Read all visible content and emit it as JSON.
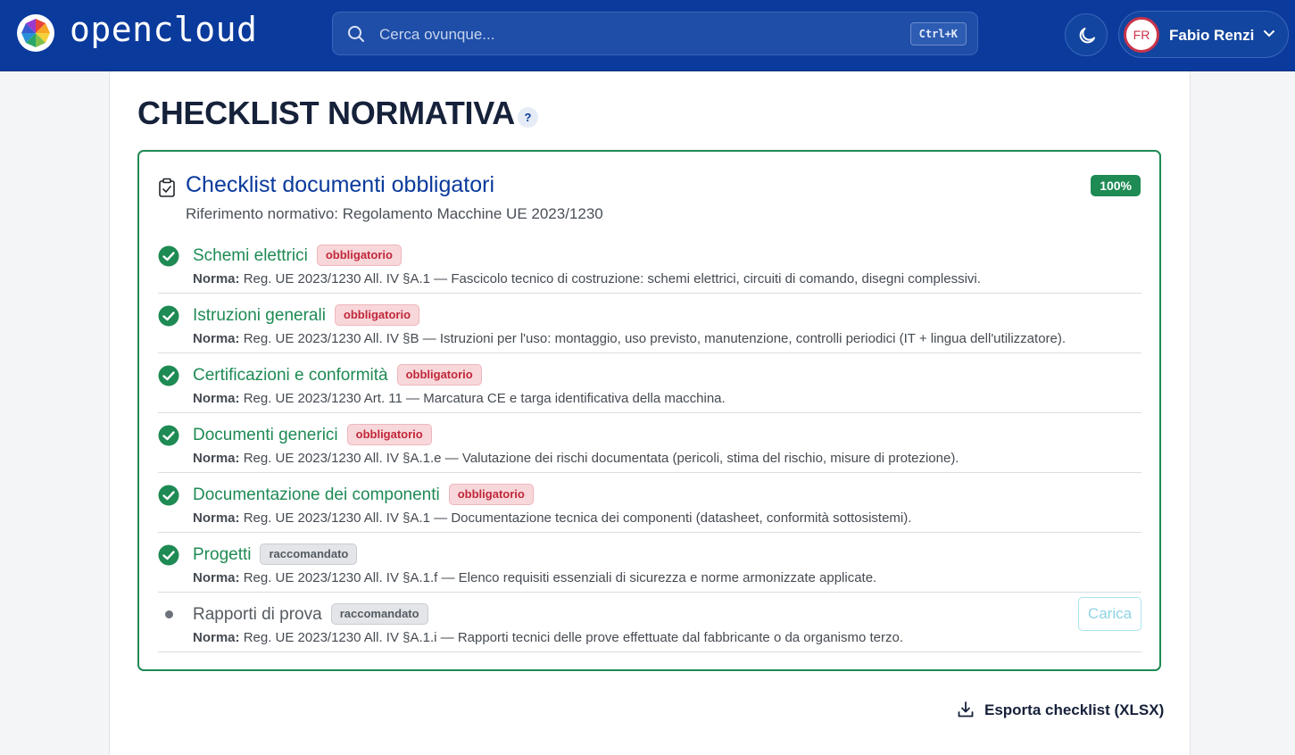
{
  "app": {
    "name": "opencloud"
  },
  "search": {
    "placeholder": "Cerca ovunque...",
    "shortcut": "Ctrl+K"
  },
  "user": {
    "initials": "FR",
    "name": "Fabio Renzi"
  },
  "page": {
    "title": "CHECKLIST NORMATIVA",
    "help": "?"
  },
  "checklist": {
    "title": "Checklist documenti obbligatori",
    "reference": "Riferimento normativo: Regolamento Macchine UE 2023/1230",
    "progress": "100%",
    "norm_label": "Norma:",
    "items": [
      {
        "name": "Schemi elettrici",
        "tag": "obbligatorio",
        "norm": "Reg. UE 2023/1230 All. IV §A.1 — Fascicolo tecnico di costruzione: schemi elettrici, circuiti di comando, disegni complessivi."
      },
      {
        "name": "Istruzioni generali",
        "tag": "obbligatorio",
        "norm": "Reg. UE 2023/1230 All. IV §B — Istruzioni per l'uso: montaggio, uso previsto, manutenzione, controlli periodici (IT + lingua dell'utilizzatore)."
      },
      {
        "name": "Certificazioni e conformità",
        "tag": "obbligatorio",
        "norm": "Reg. UE 2023/1230 Art. 11 — Marcatura CE e targa identificativa della macchina."
      },
      {
        "name": "Documenti generici",
        "tag": "obbligatorio",
        "norm": "Reg. UE 2023/1230 All. IV §A.1.e — Valutazione dei rischi documentata (pericoli, stima del rischio, misure di protezione)."
      },
      {
        "name": "Documentazione dei componenti",
        "tag": "obbligatorio",
        "norm": "Reg. UE 2023/1230 All. IV §A.1 — Documentazione tecnica dei componenti (datasheet, conformità sottosistemi)."
      },
      {
        "name": "Progetti",
        "tag": "raccomandato",
        "norm": "Reg. UE 2023/1230 All. IV §A.1.f — Elenco requisiti essenziali di sicurezza e norme armonizzate applicate."
      },
      {
        "name": "Rapporti di prova",
        "tag": "raccomandato",
        "norm": "Reg. UE 2023/1230 All. IV §A.1.i — Rapporti tecnici delle prove effettuate dal fabbricante o da organismo terzo.",
        "action": "Carica"
      }
    ]
  },
  "export": {
    "label": "Esporta checklist (XLSX)"
  },
  "colors": {
    "header": "#0a3a9c",
    "done": "#1e8a54",
    "mandatory": "#c0283a",
    "recommended": "#555b62"
  }
}
